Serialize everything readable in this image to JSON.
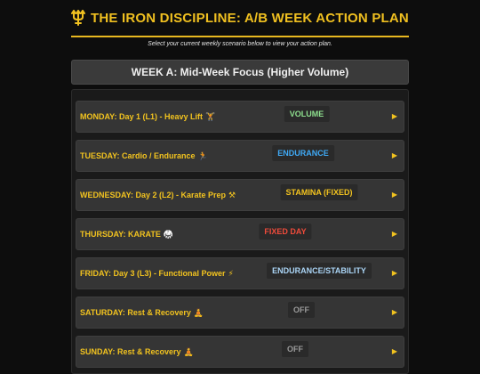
{
  "header": {
    "title": "THE IRON DISCIPLINE: A/B WEEK ACTION PLAN",
    "icon": "trident-icon",
    "accent": "#f0c020"
  },
  "subtitle": "Select your current weekly scenario below to view your action plan.",
  "week_button": {
    "label": "WEEK A: Mid-Week Focus (Higher Volume)"
  },
  "days": [
    {
      "label": "MONDAY: Day 1 (L1) - Heavy Lift",
      "emoji": "🏋",
      "badge": "VOLUME",
      "badge_color": "#8ee08e",
      "arrow": "▶"
    },
    {
      "label": "TUESDAY: Cardio / Endurance",
      "emoji": "🏃",
      "badge": "ENDURANCE",
      "badge_color": "#3fa9f5",
      "arrow": "▶"
    },
    {
      "label": "WEDNESDAY: Day 2 (L2) - Karate Prep",
      "emoji": "⚒",
      "badge": "STAMINA (FIXED)",
      "badge_color": "#f2c31f",
      "arrow": "▶"
    },
    {
      "label": "THURSDAY: KARATE",
      "emoji": "🥋",
      "badge": "FIXED DAY",
      "badge_color": "#ef4b3b",
      "arrow": "▶"
    },
    {
      "label": "FRIDAY: Day 3 (L3) - Functional Power",
      "emoji": "⚡",
      "badge": "ENDURANCE/STABILITY",
      "badge_color": "#aad4f5",
      "arrow": "▶"
    },
    {
      "label": "SATURDAY: Rest & Recovery",
      "emoji": "🧘",
      "badge": "OFF",
      "badge_color": "#9a9a9a",
      "arrow": "▶"
    },
    {
      "label": "SUNDAY: Rest & Recovery",
      "emoji": "🧘",
      "badge": "OFF",
      "badge_color": "#9a9a9a",
      "arrow": "▶"
    }
  ]
}
